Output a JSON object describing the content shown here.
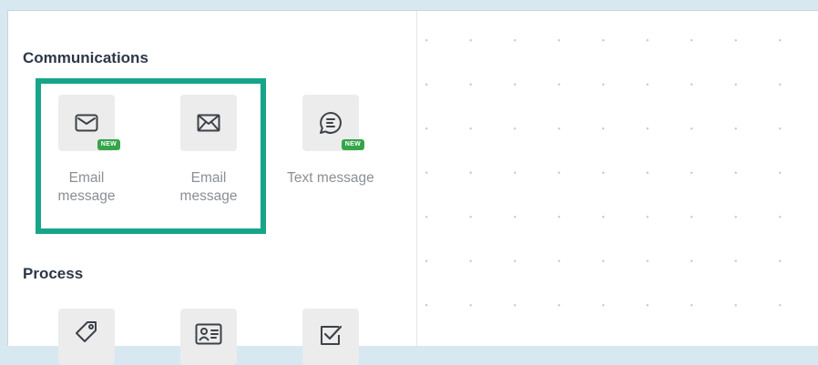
{
  "sections": {
    "communications": {
      "title": "Communications",
      "items": [
        {
          "label": "Email message",
          "icon": "envelope-icon",
          "badge": "NEW"
        },
        {
          "label": "Email message",
          "icon": "envelope-icon",
          "badge": ""
        },
        {
          "label": "Text message",
          "icon": "chat-bubble-icon",
          "badge": "NEW"
        }
      ]
    },
    "process": {
      "title": "Process",
      "items": [
        {
          "icon": "tag-icon"
        },
        {
          "icon": "contact-card-icon"
        },
        {
          "icon": "checkbox-icon"
        }
      ]
    }
  },
  "colors": {
    "highlight": "#17a58a",
    "badge": "#36a54a",
    "background": "#d7e8f1"
  }
}
